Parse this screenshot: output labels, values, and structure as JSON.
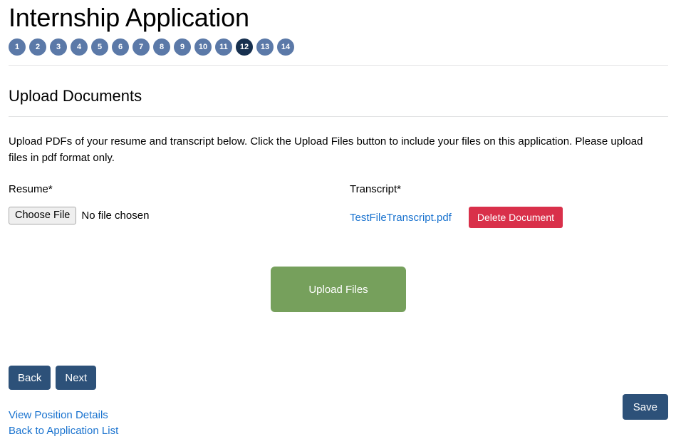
{
  "page": {
    "title": "Internship Application",
    "section_heading": "Upload Documents",
    "instructions": "Upload PDFs of your resume and transcript below. Click the Upload Files button to include your files on this application. Please upload files in pdf format only."
  },
  "colors": {
    "step_inactive": "#5b79a8",
    "step_active": "#17304f",
    "nav_button": "#2d5179",
    "upload_button": "#76a05c",
    "delete_button": "#d9304a",
    "link": "#1a73cf",
    "divider": "#e2e3e4"
  },
  "steps": {
    "items": [
      "1",
      "2",
      "3",
      "4",
      "5",
      "6",
      "7",
      "8",
      "9",
      "10",
      "11",
      "12",
      "13",
      "14"
    ],
    "active": "12"
  },
  "documents": {
    "resume": {
      "label": "Resume*",
      "choose_file_label": "Choose File",
      "file_status": "No file chosen"
    },
    "transcript": {
      "label": "Transcript*",
      "file_name": "TestFileTranscript.pdf",
      "delete_label": "Delete Document"
    }
  },
  "actions": {
    "upload_label": "Upload Files",
    "back_label": "Back",
    "next_label": "Next",
    "save_label": "Save"
  },
  "links": {
    "view_position_details": "View Position Details",
    "back_to_application_list": "Back to Application List"
  }
}
